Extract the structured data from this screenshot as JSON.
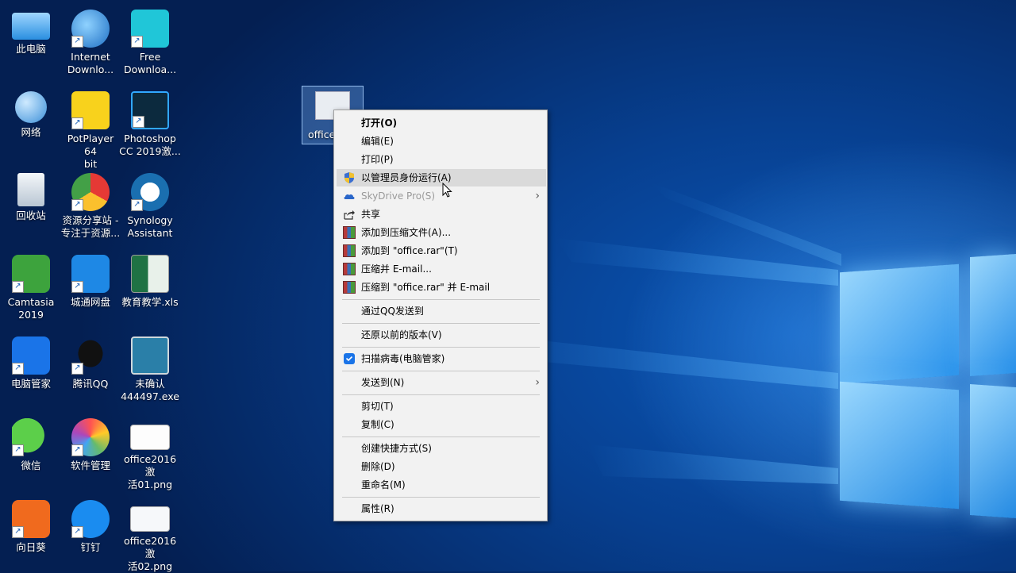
{
  "desktop": {
    "icons": [
      {
        "label": "此电脑"
      },
      {
        "label": "Internet\nDownlo..."
      },
      {
        "label": "Free\nDownloa..."
      },
      {
        "label": "网络"
      },
      {
        "label": "PotPlayer 64\nbit"
      },
      {
        "label": "Photoshop\nCC 2019激..."
      },
      {
        "label": "回收站"
      },
      {
        "label": "资源分享站 -\n专注于资源..."
      },
      {
        "label": "Synology\nAssistant"
      },
      {
        "label": "Camtasia\n2019"
      },
      {
        "label": "城通网盘"
      },
      {
        "label": "教育教学.xls"
      },
      {
        "label": "电脑管家"
      },
      {
        "label": "腾讯QQ"
      },
      {
        "label": "未确认\n444497.exe"
      },
      {
        "label": "微信"
      },
      {
        "label": "软件管理"
      },
      {
        "label": "office2016激\n活01.png"
      },
      {
        "label": "向日葵"
      },
      {
        "label": "钉钉"
      },
      {
        "label": "office2016激\n活02.png"
      }
    ],
    "selected_file": {
      "label": "office"
    }
  },
  "context_menu": {
    "items": [
      {
        "label": "打开(O)"
      },
      {
        "label": "编辑(E)"
      },
      {
        "label": "打印(P)"
      },
      {
        "label": "以管理员身份运行(A)"
      },
      {
        "label": "SkyDrive Pro(S)"
      },
      {
        "label": "共享"
      },
      {
        "label": "添加到压缩文件(A)..."
      },
      {
        "label": "添加到 \"office.rar\"(T)"
      },
      {
        "label": "压缩并 E-mail..."
      },
      {
        "label": "压缩到 \"office.rar\" 并 E-mail"
      },
      {
        "label": "通过QQ发送到"
      },
      {
        "label": "还原以前的版本(V)"
      },
      {
        "label": "扫描病毒(电脑管家)"
      },
      {
        "label": "发送到(N)"
      },
      {
        "label": "剪切(T)"
      },
      {
        "label": "复制(C)"
      },
      {
        "label": "创建快捷方式(S)"
      },
      {
        "label": "删除(D)"
      },
      {
        "label": "重命名(M)"
      },
      {
        "label": "属性(R)"
      }
    ]
  },
  "icons": {
    "shortcut": "↗",
    "submenu_arrow": "›"
  },
  "colors": {
    "desktop_blue": "#0a57b8",
    "menu_bg": "#f2f2f2",
    "menu_highlight": "#dadada"
  }
}
